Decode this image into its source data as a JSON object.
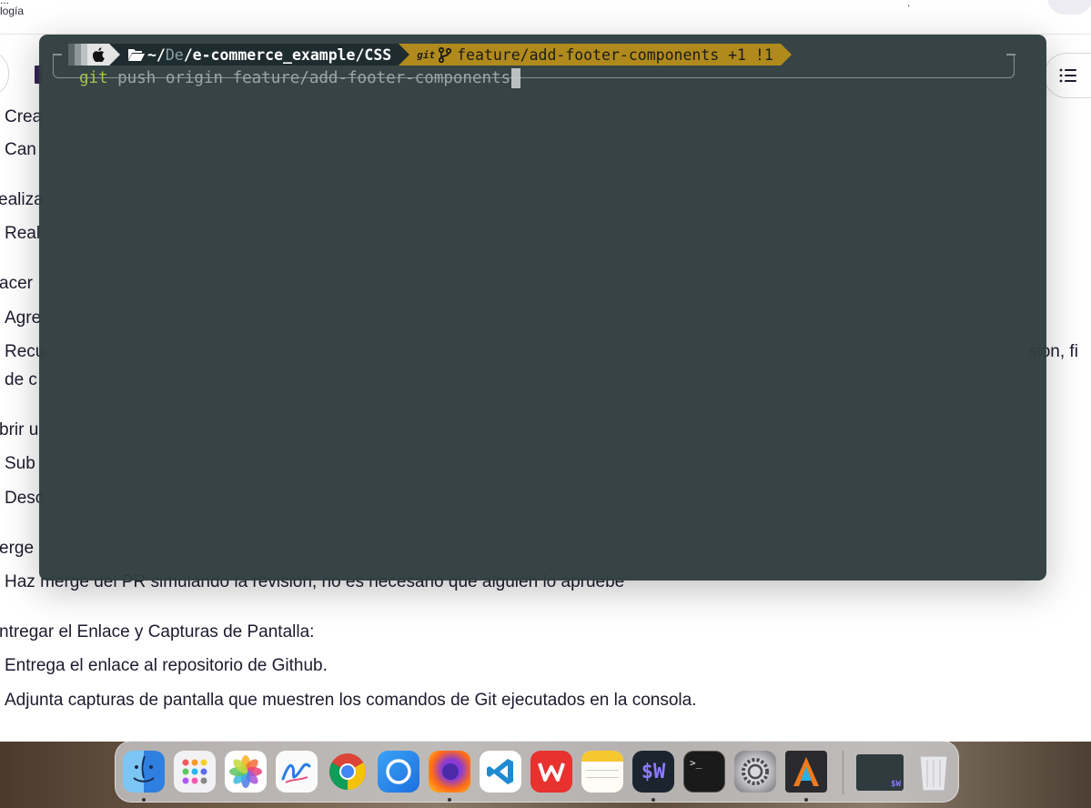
{
  "page": {
    "logo_text": [
      "...",
      "logía"
    ],
    "top_dot": "."
  },
  "doc": {
    "lines": [
      "Crea",
      "Can",
      "ealiza",
      "Real",
      "acer",
      "Agre",
      "Recu",
      "sion, fi",
      "de c",
      "brir u",
      "Sub",
      "Desc",
      "erge",
      "Haz merge del PR simulando la revisión, no es necesario que alguien lo apruebe",
      "ntregar el Enlace y Capturas de Pantalla:",
      "Entrega el enlace al repositorio de Github.",
      "Adjunta capturas de pantalla que muestren los comandos de Git ejecutados en la consola."
    ]
  },
  "terminal": {
    "prompt": {
      "path_prefix": "~/",
      "path_dim": "De",
      "path_rest": "/e-commerce_example/CSS",
      "git_label": "git",
      "branch": "feature/add-footer-components +1 !1"
    },
    "command_name": "git",
    "command_args": " push origin feature/add-footer-components"
  },
  "dock": {
    "apps": [
      {
        "name": "Finder",
        "icon": "finder-icon",
        "running": true
      },
      {
        "name": "Launchpad",
        "icon": "launchpad-icon",
        "running": false
      },
      {
        "name": "Photos",
        "icon": "photos-icon",
        "running": false
      },
      {
        "name": "Freeform",
        "icon": "freeform-icon",
        "running": false
      },
      {
        "name": "Google Chrome",
        "icon": "chrome-icon",
        "running": false
      },
      {
        "name": "Messenger",
        "icon": "messenger-icon",
        "running": false
      },
      {
        "name": "Firefox",
        "icon": "firefox-icon",
        "running": true
      },
      {
        "name": "Visual Studio Code",
        "icon": "vscode-icon",
        "running": false
      },
      {
        "name": "WPS Office",
        "icon": "wps-icon",
        "running": false
      },
      {
        "name": "Notes",
        "icon": "notes-icon",
        "running": false
      },
      {
        "name": "Warp",
        "icon": "warp-icon",
        "running": true,
        "label": "$W"
      },
      {
        "name": "Terminal",
        "icon": "terminal-icon",
        "running": false,
        "label": ">_"
      },
      {
        "name": "System Settings",
        "icon": "settings-icon",
        "running": false
      },
      {
        "name": "Alacritty",
        "icon": "alacritty-icon",
        "running": true
      },
      {
        "name": "Warp Window",
        "icon": "window-preview-icon",
        "running": false,
        "label": "$W"
      },
      {
        "name": "Trash",
        "icon": "trash-icon",
        "running": false
      }
    ]
  },
  "colors": {
    "terminal_bg": "#303e40",
    "git_segment": "#b08a1c",
    "path_segment": "#1e2c30",
    "command_green": "#a3c44a"
  }
}
